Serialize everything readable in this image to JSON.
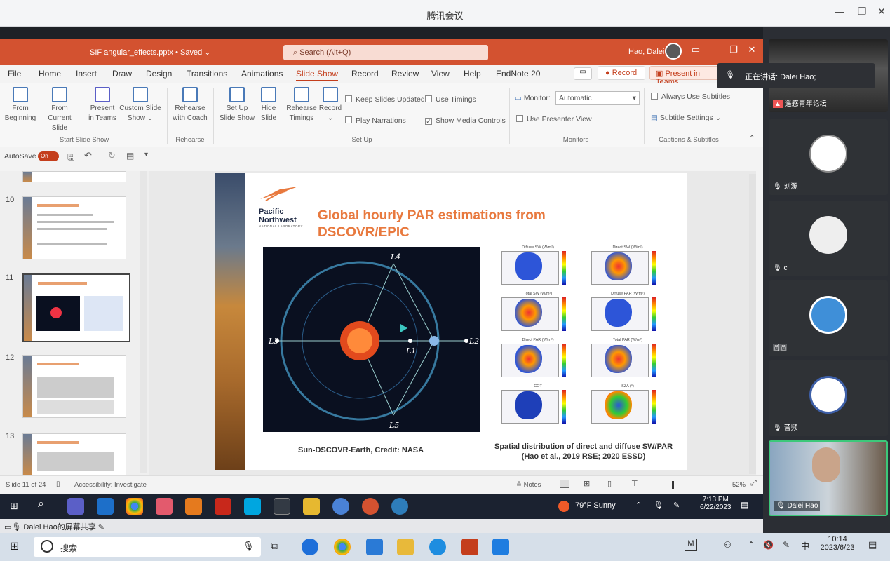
{
  "meeting": {
    "title": "腾讯会议",
    "minimize": "—",
    "restore": "❐",
    "close": "✕",
    "speaking_label": "正在讲话: Dalei Hao;",
    "share_label": "Dalei Hao的屏幕共享"
  },
  "ppt": {
    "file_name": "SIF angular_effects.pptx • Saved ⌄",
    "search_placeholder": "Search (Alt+Q)",
    "user_name": "Hao, Dalei",
    "tabs": [
      "File",
      "Home",
      "Insert",
      "Draw",
      "Design",
      "Transitions",
      "Animations",
      "Slide Show",
      "Record",
      "Review",
      "View",
      "Help",
      "EndNote 20"
    ],
    "record_btn": "● Record",
    "present_btn": "▣ Present in Teams",
    "ribbon": {
      "from_beginning": [
        "From",
        "Beginning"
      ],
      "from_current": [
        "From",
        "Current Slide"
      ],
      "present_teams": [
        "Present",
        "in Teams"
      ],
      "custom_show": [
        "Custom Slide",
        "Show ⌄"
      ],
      "rehearse_coach": [
        "Rehearse",
        "with Coach"
      ],
      "setup_show": [
        "Set Up",
        "Slide Show"
      ],
      "hide_slide": [
        "Hide",
        "Slide"
      ],
      "rehearse_timings": [
        "Rehearse",
        "Timings"
      ],
      "record": [
        "Record",
        "⌄"
      ],
      "keep_updated": "Keep Slides Updated",
      "use_timings": "Use Timings",
      "play_narrations": "Play Narrations",
      "show_media": "Show Media Controls",
      "monitor_label": "Monitor:",
      "monitor_value": "Automatic",
      "presenter_view": "Use Presenter View",
      "always_subtitles": "Always Use Subtitles",
      "subtitle_settings": "Subtitle Settings ⌄",
      "groups": [
        "Start Slide Show",
        "Rehearse",
        "Set Up",
        "Monitors",
        "Captions & Subtitles"
      ]
    },
    "autosave": "AutoSave",
    "autosave_state": "On",
    "thumb_numbers": [
      "10",
      "11",
      "12",
      "13"
    ],
    "slide": {
      "org_line1": "Pacific",
      "org_line2": "Northwest",
      "org_sub": "NATIONAL LABORATORY",
      "title": "Global hourly PAR estimations from DSCOVR/EPIC",
      "orbit_labels": [
        "L4",
        "L3",
        "L1",
        "L2",
        "L5"
      ],
      "panels": [
        "Diffuse SW (W/m²)",
        "Direct SW (W/m²)",
        "Total SW (W/m²)",
        "Diffuse PAR (W/m²)",
        "Direct PAR (W/m²)",
        "Total PAR (W/m²)",
        "COT",
        "SZA (°)"
      ],
      "caption_left": "Sun-DSCOVR-Earth, Credit: NASA",
      "caption_right": "Spatial distribution of direct and diffuse SW/PAR (Hao et al., 2019 RSE; 2020 ESSD)"
    },
    "status": {
      "slide_of": "Slide 11 of 24",
      "accessibility": "Accessibility: Investigate",
      "notes": "≙ Notes",
      "zoom": "52%"
    }
  },
  "shared_taskbar": {
    "weather": "79°F  Sunny",
    "time": "7:13 PM",
    "date": "6/22/2023"
  },
  "participants": [
    {
      "name": "遥感青年论坛"
    },
    {
      "name": "刘源"
    },
    {
      "name": "c"
    },
    {
      "name": "圆圆"
    },
    {
      "name": "音频"
    },
    {
      "name": "Dalei Hao"
    }
  ],
  "host_taskbar": {
    "search": "搜索",
    "time": "10:14",
    "date": "2023/6/23",
    "ime": "中"
  },
  "colors": {
    "ppt_accent": "#d35230",
    "title_orange": "#e8793e"
  }
}
